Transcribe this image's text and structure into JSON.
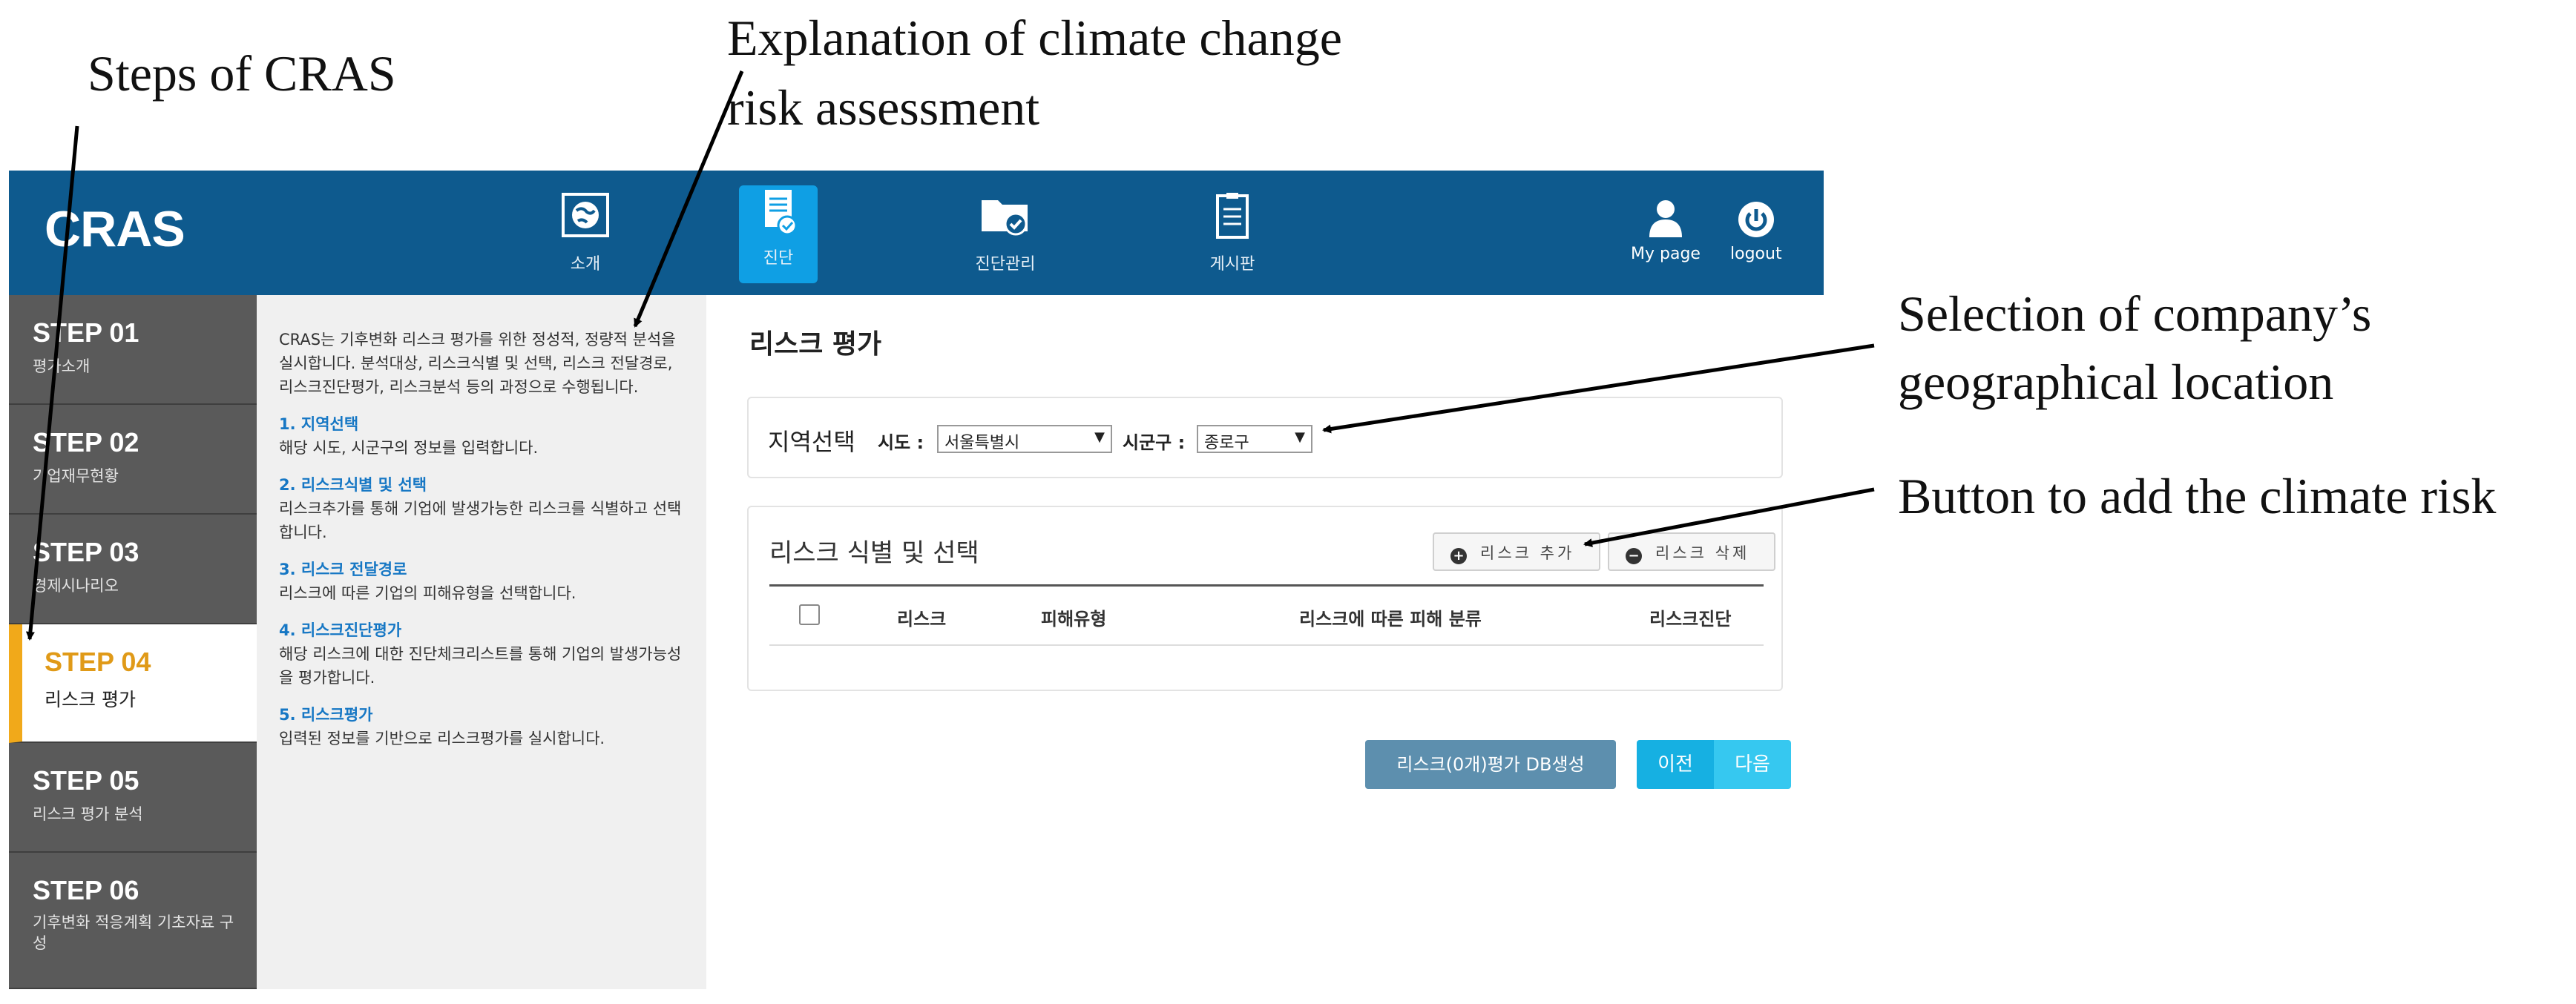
{
  "annotations": {
    "steps": "Steps of CRAS",
    "explanation_line1": "Explanation  of climate change",
    "explanation_line2": "risk assessment",
    "location_line1": "Selection of company’s",
    "location_line2": "geographical  location",
    "add_risk": "Button to add the climate risk"
  },
  "app": {
    "logo": "CRAS",
    "nav": [
      {
        "label": "소개",
        "icon": "globe-icon"
      },
      {
        "label": "진단",
        "icon": "document-check-icon"
      },
      {
        "label": "진단관리",
        "icon": "folder-check-icon"
      },
      {
        "label": "게시판",
        "icon": "clipboard-icon"
      }
    ],
    "mypage": "My page",
    "logout": "logout"
  },
  "steps": [
    {
      "num": "STEP 01",
      "sub": "평가소개"
    },
    {
      "num": "STEP 02",
      "sub": "기업재무현황"
    },
    {
      "num": "STEP 03",
      "sub": "경제시나리오"
    },
    {
      "num": "STEP 04",
      "sub": "리스크 평가"
    },
    {
      "num": "STEP 05",
      "sub": "리스크 평가 분석"
    },
    {
      "num": "STEP 06",
      "sub": "기후변화 적응계획 기초자료 구성"
    }
  ],
  "explain": {
    "intro": "CRAS는 기후변화 리스크 평가를 위한 정성적, 정량적 분석을 실시합니다. 분석대상, 리스크식별 및 선택, 리스크 전달경로, 리스크진단평가, 리스크분석 등의 과정으로 수행됩니다.",
    "items": [
      {
        "h": "1. 지역선택",
        "t": "해당 시도, 시군구의 정보를 입력합니다."
      },
      {
        "h": "2. 리스크식별 및 선택",
        "t": "리스크추가를 통해 기업에 발생가능한 리스크를 식별하고 선택합니다."
      },
      {
        "h": "3. 리스크 전달경로",
        "t": "리스크에 따른 기업의 피해유형을 선택합니다."
      },
      {
        "h": "4. 리스크진단평가",
        "t": "해당 리스크에 대한 진단체크리스트를 통해 기업의 발생가능성을 평가합니다."
      },
      {
        "h": "5. 리스크평가",
        "t": "입력된 정보를 기반으로 리스크평가를 실시합니다."
      }
    ]
  },
  "main": {
    "title": "리스크 평가",
    "region_title": "지역선택",
    "sido_label": "시도 :",
    "sido_value": "서울특별시",
    "sigungu_label": "시군구 :",
    "sigungu_value": "종로구",
    "risk_title": "리스크 식별 및 선택",
    "add_risk": "리스크 추가",
    "delete_risk": "리스크 삭제",
    "columns": [
      "리스크",
      "피해유형",
      "리스크에 따른 피해 분류",
      "리스크진단"
    ],
    "generate_db": "리스크(0개)평가 DB생성",
    "prev": "이전",
    "next": "다음"
  },
  "colors": {
    "header": "#0e5a8e",
    "active_nav": "#0f9fe4",
    "step_active_accent": "#f1a91a",
    "sidebar": "#5a5a5a"
  }
}
